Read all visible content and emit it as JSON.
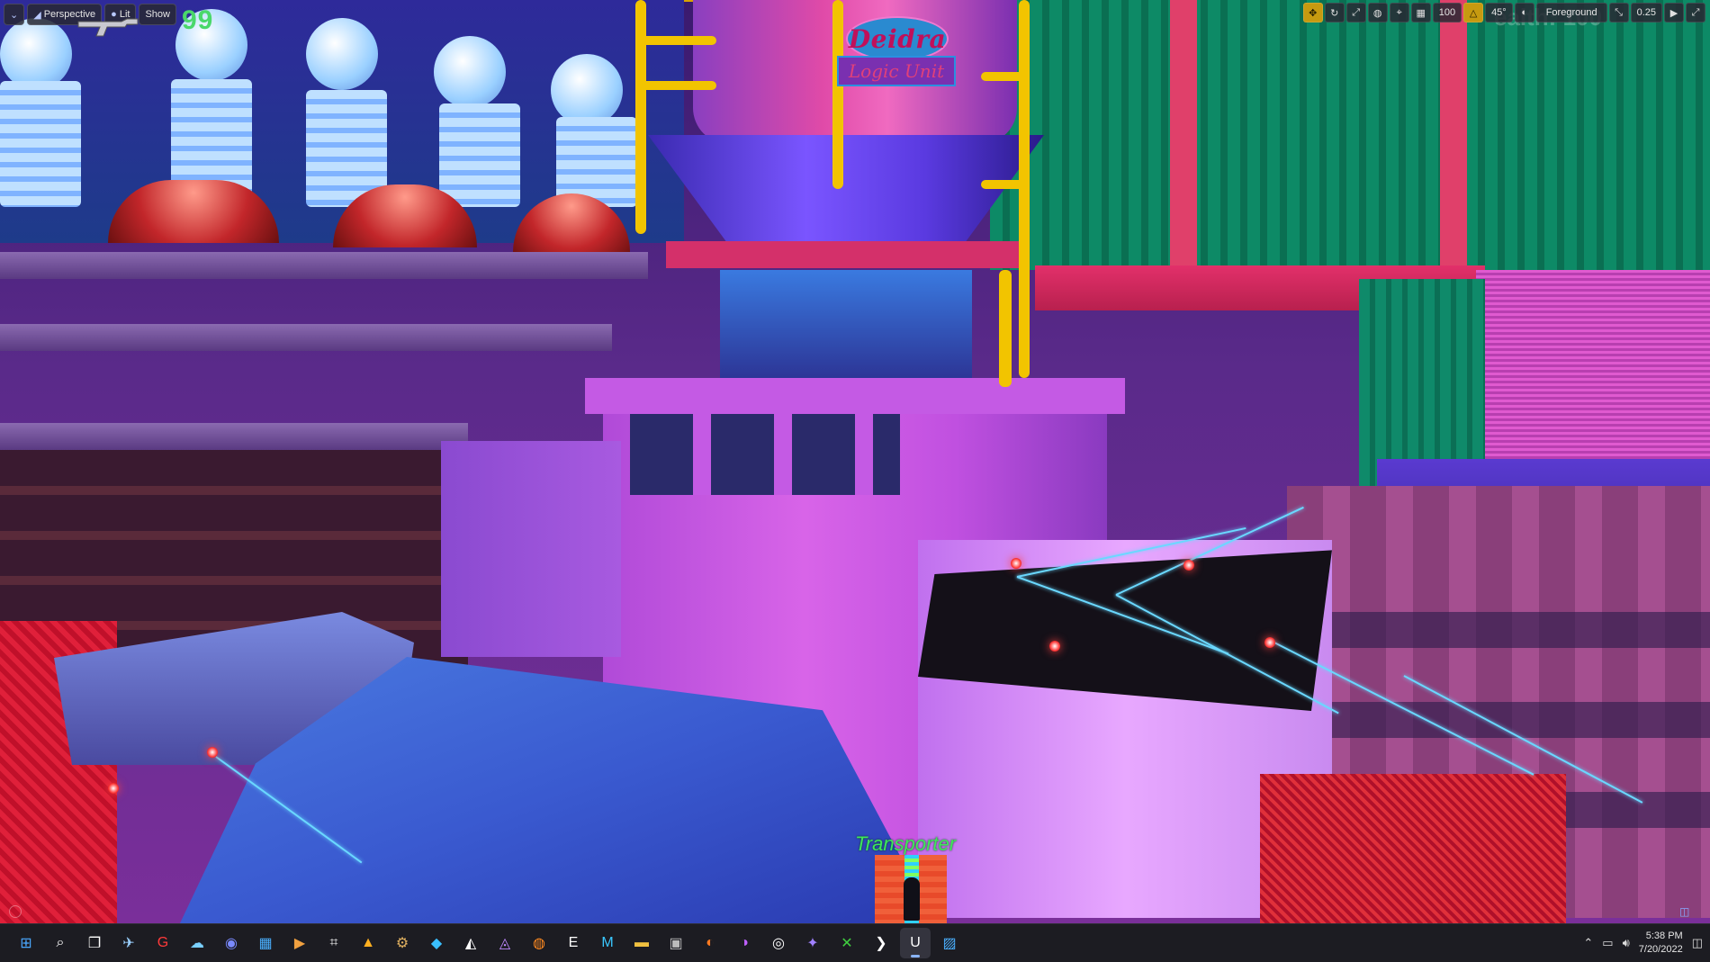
{
  "viewport": {
    "view_mode": "Perspective",
    "lighting_mode": "Lit",
    "show_menu": "Show",
    "fps": "99",
    "camera_speed": "100",
    "snap_angle": "45°",
    "foreground_mode": "Foreground",
    "scale_value": "0.25",
    "ghost_text": "ealth: 100"
  },
  "scene_labels": {
    "sign_top": "Deidra",
    "sign_bottom": "Logic Unit",
    "transporter": "Transporter"
  },
  "taskbar": {
    "apps": [
      {
        "icon": "windows-start-icon",
        "glyph": "⊞",
        "color": "#4aa8ff"
      },
      {
        "icon": "search-icon",
        "glyph": "⌕",
        "color": "#ffffff"
      },
      {
        "icon": "task-view-icon",
        "glyph": "❐",
        "color": "#ffffff"
      },
      {
        "icon": "plane-app-icon",
        "glyph": "✈",
        "color": "#9ad0ff"
      },
      {
        "icon": "g-hub-icon",
        "glyph": "G",
        "color": "#ff3a3a"
      },
      {
        "icon": "cloud-app-icon",
        "glyph": "☁",
        "color": "#7ad0ff"
      },
      {
        "icon": "discord-icon",
        "glyph": "◉",
        "color": "#7a8aff"
      },
      {
        "icon": "widgets-icon",
        "glyph": "▦",
        "color": "#4ab0ff"
      },
      {
        "icon": "media-player-icon",
        "glyph": "▶",
        "color": "#f0a040"
      },
      {
        "icon": "snipping-tool-icon",
        "glyph": "⌗",
        "color": "#ffffff"
      },
      {
        "icon": "autodesk-icon",
        "glyph": "▲",
        "color": "#ffb020"
      },
      {
        "icon": "settings-app-icon",
        "glyph": "⚙",
        "color": "#e0b060"
      },
      {
        "icon": "blue-diamond-icon",
        "glyph": "◆",
        "color": "#3ac0ff"
      },
      {
        "icon": "unity-icon",
        "glyph": "◭",
        "color": "#ffffff"
      },
      {
        "icon": "affinity-icon",
        "glyph": "◬",
        "color": "#c08aff"
      },
      {
        "icon": "blender-icon",
        "glyph": "◍",
        "color": "#ff8a20"
      },
      {
        "icon": "epic-games-icon",
        "glyph": "E",
        "color": "#ffffff"
      },
      {
        "icon": "maya-icon",
        "glyph": "M",
        "color": "#3ac8ff"
      },
      {
        "icon": "file-explorer-icon",
        "glyph": "▬",
        "color": "#f0c040"
      },
      {
        "icon": "terminal-icon",
        "glyph": "▣",
        "color": "#bbbbbb"
      },
      {
        "icon": "firefox-icon",
        "glyph": "◐",
        "color": "#ff7a20"
      },
      {
        "icon": "firefox-private-icon",
        "glyph": "◑",
        "color": "#c060ff"
      },
      {
        "icon": "eye-app-icon",
        "glyph": "◎",
        "color": "#ffffff"
      },
      {
        "icon": "game-controller-icon",
        "glyph": "✦",
        "color": "#a080ff"
      },
      {
        "icon": "xbox-icon",
        "glyph": "✕",
        "color": "#40d040"
      },
      {
        "icon": "arrow-app-icon",
        "glyph": "❯",
        "color": "#ffffff"
      },
      {
        "icon": "unreal-engine-icon",
        "glyph": "U",
        "color": "#ffffff"
      },
      {
        "icon": "photos-icon",
        "glyph": "▨",
        "color": "#4ab0ff"
      }
    ],
    "time": "5:38 PM",
    "date": "7/20/2022"
  }
}
